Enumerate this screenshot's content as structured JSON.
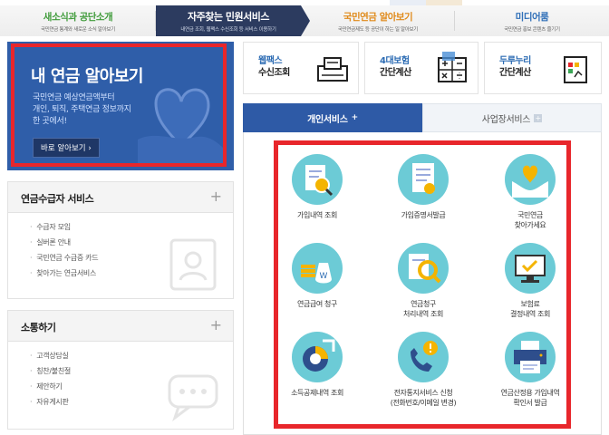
{
  "tabs": [
    {
      "title": "새소식과 공단소개",
      "sub": "국민연금 통계와 새로운 소식 알아보기"
    },
    {
      "title": "자주찾는 민원서비스",
      "sub": "내연금 조회, 웹팩스 수신조회 등 서비스 이용하기"
    },
    {
      "title": "국민연금 알아보기",
      "sub": "국민연금제도 등 공단이 하는 일 알아보기"
    },
    {
      "title": "미디어룸",
      "sub": "국민연금 홍보 콘텐츠 즐기기"
    }
  ],
  "promo": {
    "title": "내 연금 알아보기",
    "desc_lines": [
      "국민연금 예상연금액부터",
      "개인, 퇴직, 주택연금 정보까지",
      "한 곳에서!"
    ],
    "button": "바로 알아보기 ›"
  },
  "sections": [
    {
      "title": "연금수급자 서비스",
      "plus": "+",
      "items": [
        "수급자 모임",
        "실버론 안내",
        "국민연금 수급증 카드",
        "찾아가는 연금서비스"
      ]
    },
    {
      "title": "소통하기",
      "plus": "+",
      "items": [
        "고객상담실",
        "칭찬/불친절",
        "제안하기",
        "자유게시판"
      ]
    }
  ],
  "quick": [
    {
      "line1": "웹팩스",
      "line2": "수신조회",
      "icon": "fax-icon"
    },
    {
      "line1": "4대보험",
      "line2": "간단계산",
      "icon": "calculator-icon"
    },
    {
      "line1": "두루누리",
      "line2": "간단계산",
      "icon": "chart-document-icon"
    }
  ],
  "service_tabs": {
    "personal": "개인서비스",
    "business": "사업장서비스",
    "plus": "+"
  },
  "services": [
    {
      "lines": [
        "가입내역 조회"
      ],
      "icon": "document-search-icon"
    },
    {
      "lines": [
        "가입증명서발급"
      ],
      "icon": "certificate-icon"
    },
    {
      "lines": [
        "국민연금",
        "찾아가세요"
      ],
      "icon": "heart-hands-icon"
    },
    {
      "lines": [
        "연금급여 청구"
      ],
      "icon": "money-bag-icon"
    },
    {
      "lines": [
        "연금청구",
        "처리내역 조회"
      ],
      "icon": "search-document-icon"
    },
    {
      "lines": [
        "보험료",
        "결정내역 조회"
      ],
      "icon": "monitor-check-icon"
    },
    {
      "lines": [
        "소득공제내역 조회"
      ],
      "icon": "pie-chart-icon"
    },
    {
      "lines": [
        "전자통지서비스 신청",
        "(전화번호/이메일 변경)"
      ],
      "icon": "phone-alert-icon"
    },
    {
      "lines": [
        "연금산정용 가입내역",
        "확인서 발급"
      ],
      "icon": "printer-icon"
    }
  ]
}
